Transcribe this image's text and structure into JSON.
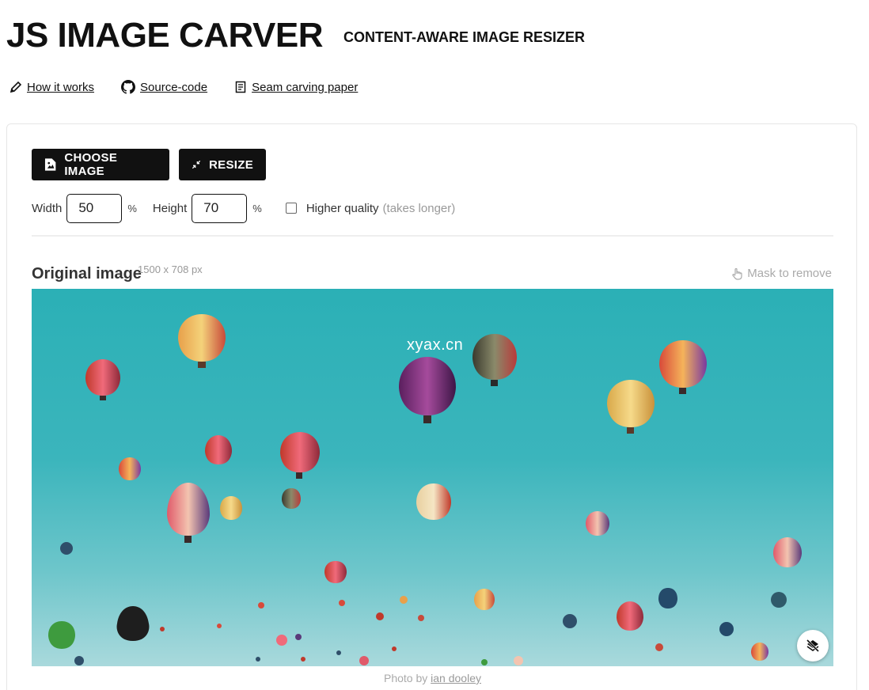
{
  "header": {
    "title": "JS IMAGE CARVER",
    "subtitle": "CONTENT-AWARE IMAGE RESIZER"
  },
  "links": [
    {
      "label": "How it works",
      "icon": "pencil-icon"
    },
    {
      "label": "Source-code",
      "icon": "github-icon"
    },
    {
      "label": "Seam carving paper",
      "icon": "document-icon"
    }
  ],
  "toolbar": {
    "choose_label": "CHOOSE IMAGE",
    "resize_label": "RESIZE"
  },
  "controls": {
    "width_label": "Width",
    "width_value": "50",
    "height_label": "Height",
    "height_value": "70",
    "unit": "%",
    "quality_label": "Higher quality",
    "quality_hint": "(takes longer)",
    "quality_checked": false
  },
  "image_section": {
    "title": "Original image",
    "dimensions": "1500 x 708 px",
    "mask_label": "Mask to remove",
    "watermark": "xyax.cn",
    "caption_prefix": "Photo by",
    "caption_author": "ian dooley"
  },
  "colors": {
    "button_bg": "#111111",
    "sky_top": "#2bb0b6",
    "sky_bottom": "#a9d9dc"
  }
}
